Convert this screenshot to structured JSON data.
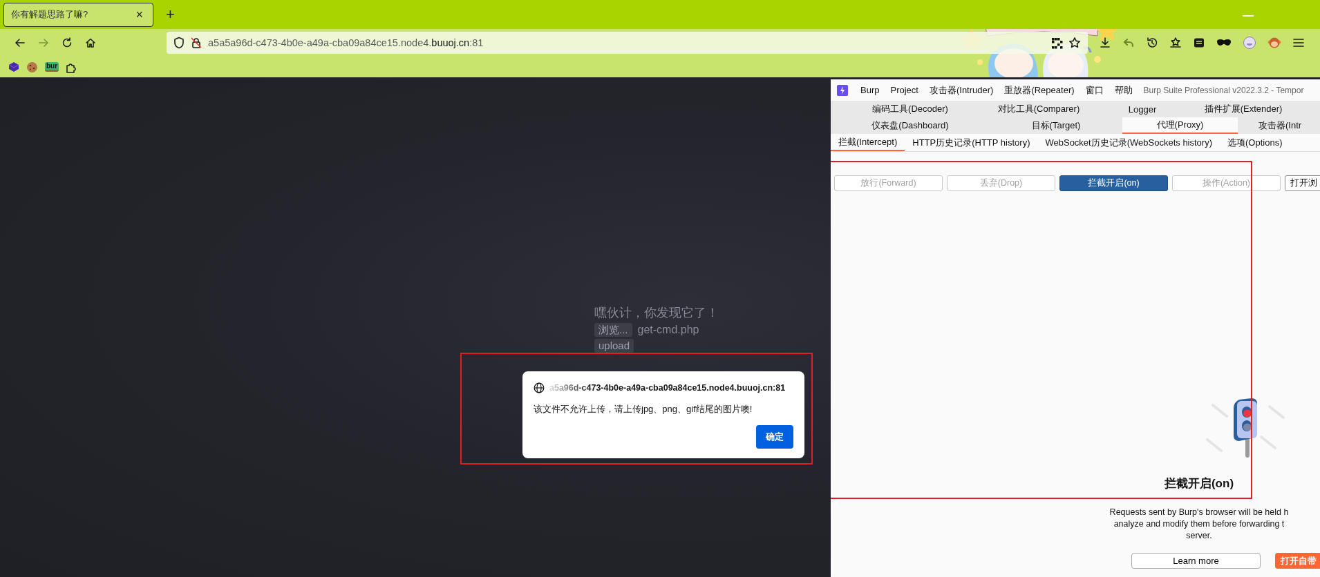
{
  "browser": {
    "tab": {
      "title": "你有解题思路了嘛?",
      "close": "×",
      "selected": true
    },
    "new_tab": "+",
    "nav_buttons": [
      {
        "kind": "back",
        "disabled": false
      },
      {
        "kind": "forward",
        "disabled": true
      },
      {
        "kind": "reload",
        "disabled": false
      },
      {
        "kind": "home",
        "disabled": false
      }
    ],
    "url": {
      "prefix": "a5a5a96d-c473-4b0e-a49a-cba09a84ce15.node4.",
      "domain": "buuoj.cn",
      "suffix": ":81"
    },
    "bookmark_badge": "bur"
  },
  "page": {
    "heading": "嘿伙计，你发现它了！",
    "browse_button": "浏览...",
    "file_name": "get-cmd.php",
    "upload_button": "upload"
  },
  "dialog": {
    "origin": "a5a96d-c473-4b0e-a49a-cba09a84ce15.node4.buuoj.cn:81",
    "message": "该文件不允许上传，请上传jpg、png、gif结尾的图片噢!",
    "ok": "确定"
  },
  "burp": {
    "menu": [
      "Burp",
      "Project",
      "攻击器(Intruder)",
      "重放器(Repeater)",
      "窗口",
      "帮助"
    ],
    "title": "Burp Suite Professional v2022.3.2 - Tempor",
    "tab_rows": [
      [
        {
          "label": "编码工具(Decoder)",
          "selected": false
        },
        {
          "label": "对比工具(Comparer)",
          "selected": false
        },
        {
          "label": "Logger",
          "selected": false
        },
        {
          "label": "插件扩展(Extender)",
          "selected": false
        }
      ],
      [
        {
          "label": "仪表盘(Dashboard)",
          "selected": false
        },
        {
          "label": "目标(Target)",
          "selected": false
        },
        {
          "label": "代理(Proxy)",
          "selected": true
        },
        {
          "label": "攻击器(Intr",
          "selected": false
        }
      ]
    ],
    "subtabs": [
      {
        "label": "拦截(Intercept)",
        "selected": true
      },
      {
        "label": "HTTP历史记录(HTTP history)",
        "selected": false
      },
      {
        "label": "WebSocket历史记录(WebSockets history)",
        "selected": false
      },
      {
        "label": "选项(Options)",
        "selected": false
      }
    ],
    "actions": [
      {
        "label": "放行(Forward)",
        "disabled": true,
        "pressed": false
      },
      {
        "label": "丢弃(Drop)",
        "disabled": true,
        "pressed": false
      },
      {
        "label": "拦截开启(on)",
        "disabled": false,
        "pressed": true
      },
      {
        "label": "操作(Action)",
        "disabled": true,
        "pressed": false
      },
      {
        "label": "打开浏",
        "disabled": false,
        "pressed": false
      }
    ],
    "intercept_panel": {
      "heading": "拦截开启(on)",
      "description_lines": [
        "Requests sent by Burp's browser will be held h",
        "analyze and modify them before forwarding t",
        "server."
      ],
      "learn_more": "Learn more",
      "open_browser": "打开自带"
    }
  }
}
